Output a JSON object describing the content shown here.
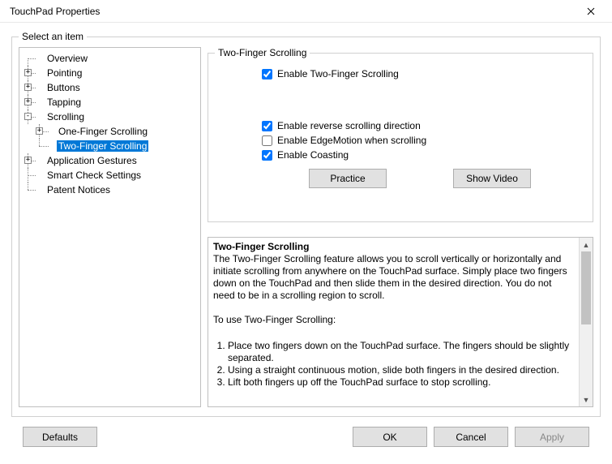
{
  "window": {
    "title": "TouchPad Properties"
  },
  "outer_group": {
    "legend": "Select an item"
  },
  "tree": {
    "items": [
      {
        "label": "Overview",
        "expander": ""
      },
      {
        "label": "Pointing",
        "expander": "+"
      },
      {
        "label": "Buttons",
        "expander": "+"
      },
      {
        "label": "Tapping",
        "expander": "+"
      },
      {
        "label": "Scrolling",
        "expander": "-",
        "children": [
          {
            "label": "One-Finger Scrolling",
            "expander": "+"
          },
          {
            "label": "Two-Finger Scrolling",
            "expander": "",
            "selected": true
          }
        ]
      },
      {
        "label": "Application Gestures",
        "expander": "+"
      },
      {
        "label": "Smart Check Settings",
        "expander": ""
      },
      {
        "label": "Patent Notices",
        "expander": ""
      }
    ]
  },
  "settings": {
    "legend": "Two-Finger Scrolling",
    "enable_label": "Enable Two-Finger Scrolling",
    "enable_checked": true,
    "reverse_label": "Enable reverse scrolling direction",
    "reverse_checked": true,
    "edgemotion_label": "Enable EdgeMotion when scrolling",
    "edgemotion_checked": false,
    "coasting_label": "Enable Coasting",
    "coasting_checked": true,
    "practice_btn": "Practice",
    "show_video_btn": "Show Video"
  },
  "description": {
    "title": "Two-Finger Scrolling",
    "intro": "The Two-Finger Scrolling feature allows you to scroll vertically or horizontally and initiate scrolling from anywhere on the TouchPad surface. Simply place two fingers down on the TouchPad and then slide them in the desired direction. You do not need to be in a scrolling region to scroll.",
    "howto_heading": "To use Two-Finger Scrolling:",
    "steps": [
      "Place two fingers down on the TouchPad surface. The fingers should be slightly separated.",
      "Using a straight continuous motion, slide both fingers in the desired direction.",
      "Lift both fingers up off the TouchPad surface to stop scrolling."
    ]
  },
  "buttons": {
    "defaults": "Defaults",
    "ok": "OK",
    "cancel": "Cancel",
    "apply": "Apply"
  }
}
